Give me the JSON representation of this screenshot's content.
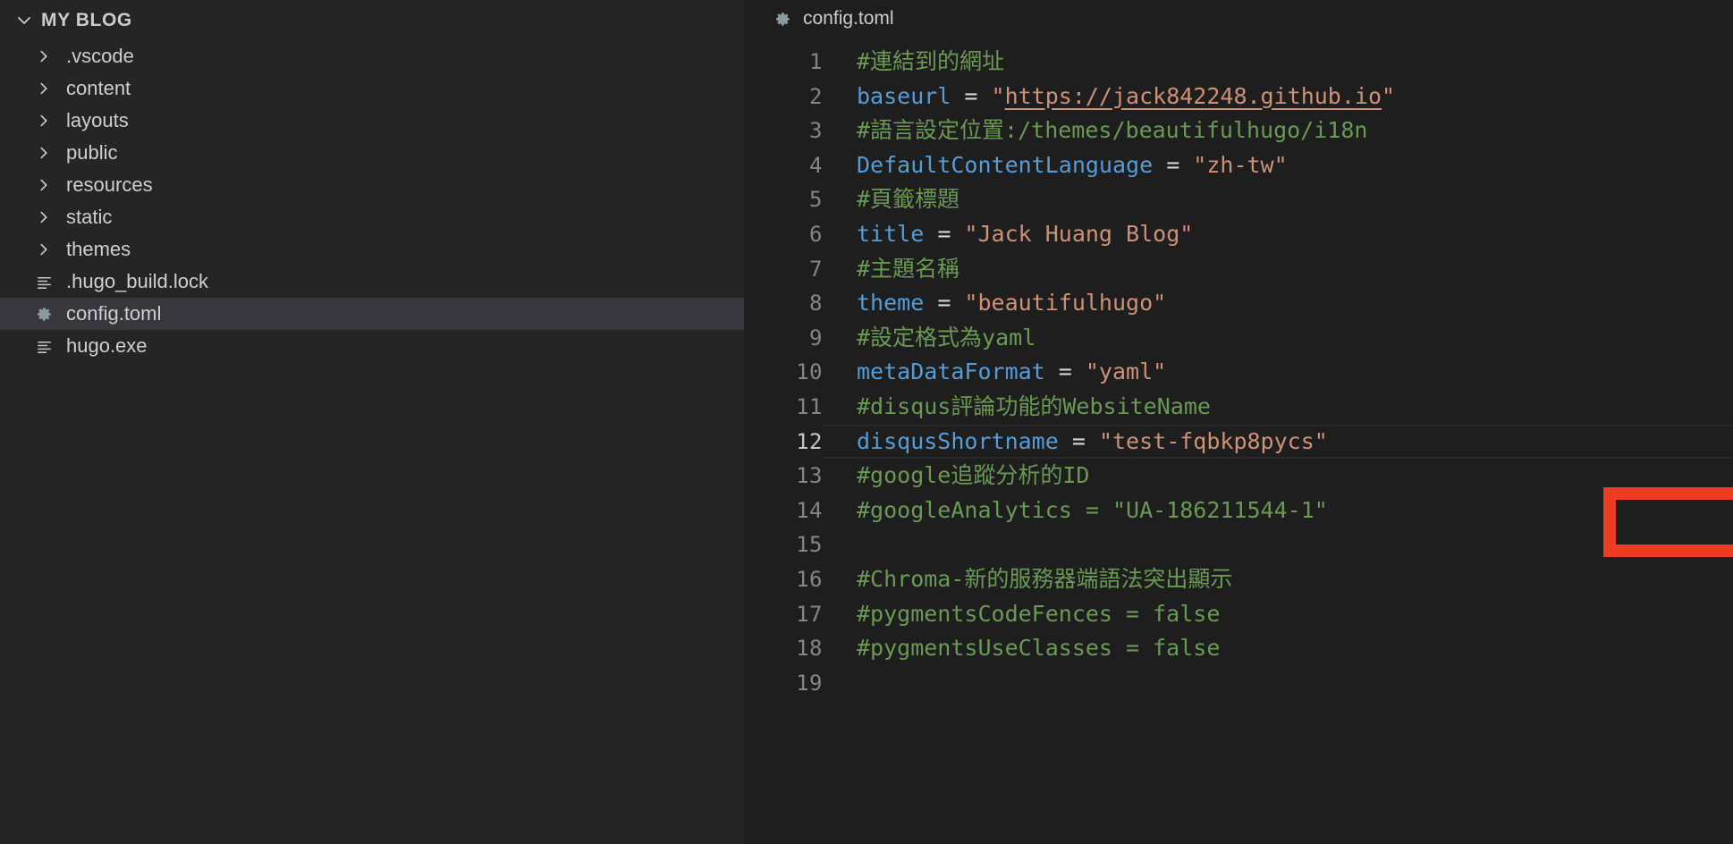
{
  "sidebar": {
    "root": {
      "label": "MY BLOG",
      "twisty_icon": "chevron-down-icon",
      "expanded": true
    },
    "items": [
      {
        "label": ".vscode",
        "icon": "chevron-right-icon",
        "type": "folder",
        "selected": false
      },
      {
        "label": "content",
        "icon": "chevron-right-icon",
        "type": "folder",
        "selected": false
      },
      {
        "label": "layouts",
        "icon": "chevron-right-icon",
        "type": "folder",
        "selected": false
      },
      {
        "label": "public",
        "icon": "chevron-right-icon",
        "type": "folder",
        "selected": false
      },
      {
        "label": "resources",
        "icon": "chevron-right-icon",
        "type": "folder",
        "selected": false
      },
      {
        "label": "static",
        "icon": "chevron-right-icon",
        "type": "folder",
        "selected": false
      },
      {
        "label": "themes",
        "icon": "chevron-right-icon",
        "type": "folder",
        "selected": false
      },
      {
        "label": ".hugo_build.lock",
        "icon": "file-lines-icon",
        "type": "file",
        "selected": false
      },
      {
        "label": "config.toml",
        "icon": "gear-icon",
        "type": "file",
        "selected": true
      },
      {
        "label": "hugo.exe",
        "icon": "file-lines-icon",
        "type": "file",
        "selected": false
      }
    ]
  },
  "editor": {
    "breadcrumb": {
      "icon": "gear-icon",
      "filename": "config.toml"
    },
    "lines": [
      {
        "n": "1",
        "tokens": [
          {
            "text": "#連結到的網址",
            "cls": "t-comment"
          }
        ]
      },
      {
        "n": "2",
        "tokens": [
          {
            "text": "baseurl",
            "cls": "t-key"
          },
          {
            "text": " = ",
            "cls": "t-op"
          },
          {
            "text": "\"",
            "cls": "t-str"
          },
          {
            "text": "https://jack842248.github.io",
            "cls": "t-link"
          },
          {
            "text": "\"",
            "cls": "t-str"
          }
        ]
      },
      {
        "n": "3",
        "tokens": [
          {
            "text": "#語言設定位置:/themes/beautifulhugo/i18n",
            "cls": "t-comment"
          }
        ]
      },
      {
        "n": "4",
        "tokens": [
          {
            "text": "DefaultContentLanguage",
            "cls": "t-key"
          },
          {
            "text": " = ",
            "cls": "t-op"
          },
          {
            "text": "\"zh-tw\"",
            "cls": "t-str"
          }
        ]
      },
      {
        "n": "5",
        "tokens": [
          {
            "text": "#頁籤標題",
            "cls": "t-comment"
          }
        ]
      },
      {
        "n": "6",
        "tokens": [
          {
            "text": "title",
            "cls": "t-key"
          },
          {
            "text": " = ",
            "cls": "t-op"
          },
          {
            "text": "\"Jack Huang Blog\"",
            "cls": "t-str"
          }
        ]
      },
      {
        "n": "7",
        "tokens": [
          {
            "text": "#主題名稱",
            "cls": "t-comment"
          }
        ]
      },
      {
        "n": "8",
        "tokens": [
          {
            "text": "theme",
            "cls": "t-key"
          },
          {
            "text": " = ",
            "cls": "t-op"
          },
          {
            "text": "\"beautifulhugo\"",
            "cls": "t-str"
          }
        ]
      },
      {
        "n": "9",
        "tokens": [
          {
            "text": "#設定格式為yaml",
            "cls": "t-comment"
          }
        ]
      },
      {
        "n": "10",
        "tokens": [
          {
            "text": "metaDataFormat",
            "cls": "t-key"
          },
          {
            "text": " = ",
            "cls": "t-op"
          },
          {
            "text": "\"yaml\"",
            "cls": "t-str"
          }
        ]
      },
      {
        "n": "11",
        "tokens": [
          {
            "text": "#disqus評論功能的WebsiteName",
            "cls": "t-comment"
          }
        ]
      },
      {
        "n": "12",
        "current": true,
        "tokens": [
          {
            "text": "disqusShortname",
            "cls": "t-key"
          },
          {
            "text": " = ",
            "cls": "t-op"
          },
          {
            "text": "\"test-fqbkp8pycs\"",
            "cls": "t-str"
          }
        ]
      },
      {
        "n": "13",
        "tokens": [
          {
            "text": "#google追蹤分析的ID",
            "cls": "t-comment"
          }
        ]
      },
      {
        "n": "14",
        "tokens": [
          {
            "text": "#googleAnalytics = \"UA-186211544-1\"",
            "cls": "t-comment"
          }
        ]
      },
      {
        "n": "15",
        "tokens": [
          {
            "text": "",
            "cls": "t-op"
          }
        ]
      },
      {
        "n": "16",
        "tokens": [
          {
            "text": "#Chroma-新的服務器端語法突出顯示",
            "cls": "t-comment"
          }
        ]
      },
      {
        "n": "17",
        "tokens": [
          {
            "text": "#pygmentsCodeFences = false",
            "cls": "t-comment"
          }
        ]
      },
      {
        "n": "18",
        "tokens": [
          {
            "text": "#pygmentsUseClasses = false",
            "cls": "t-comment"
          }
        ]
      },
      {
        "n": "19",
        "tokens": [
          {
            "text": "",
            "cls": "t-op"
          }
        ]
      }
    ]
  },
  "annotation": {
    "name": "red-highlight-box",
    "target_line": "12",
    "color": "#ee3b24"
  },
  "colors": {
    "sidebar_bg": "#252526",
    "editor_bg": "#1e1e1e",
    "selected_row_bg": "#37373d",
    "comment": "#6a9955",
    "keyword": "#569cd6",
    "string": "#ce9178",
    "line_number": "#858585",
    "foreground": "#d4d4d4",
    "annotation_red": "#ee3b24"
  }
}
